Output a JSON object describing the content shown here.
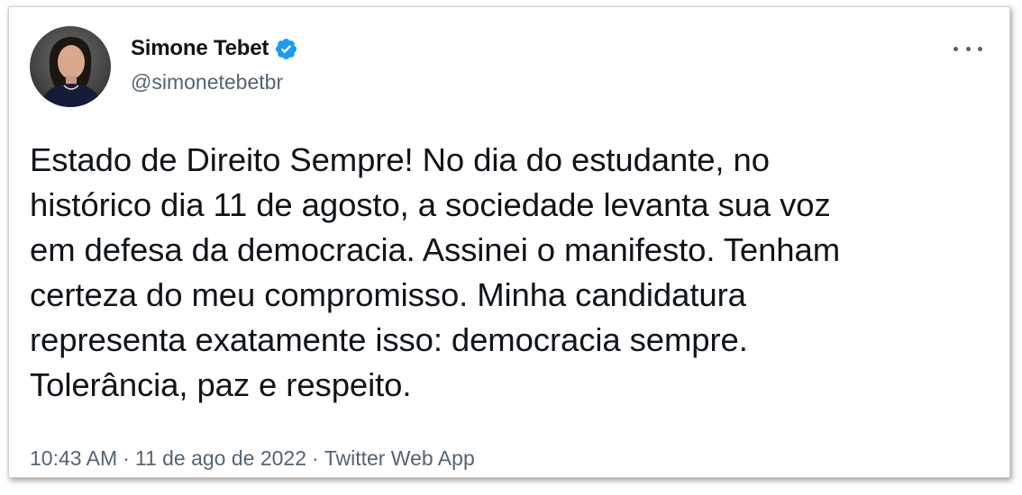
{
  "tweet": {
    "author": {
      "display_name": "Simone Tebet",
      "handle": "@simonetebetbr",
      "verified": true,
      "verified_color": "#1d9bf0"
    },
    "text": "Estado de Direito Sempre! No dia do estudante, no\nhistórico dia 11 de agosto, a sociedade levanta sua voz\nem defesa da democracia. Assinei o manifesto. Tenham\ncerteza do meu compromisso. Minha candidatura\nrepresenta exatamente isso: democracia sempre.\nTolerância, paz e respeito.",
    "time": "10:43 AM",
    "separator": "·",
    "date": "11 de ago de 2022",
    "source": "Twitter Web App",
    "more_icon": "more-horizontal-icon"
  },
  "colors": {
    "text_primary": "#0f1419",
    "text_secondary": "#536471",
    "accent": "#1d9bf0"
  }
}
